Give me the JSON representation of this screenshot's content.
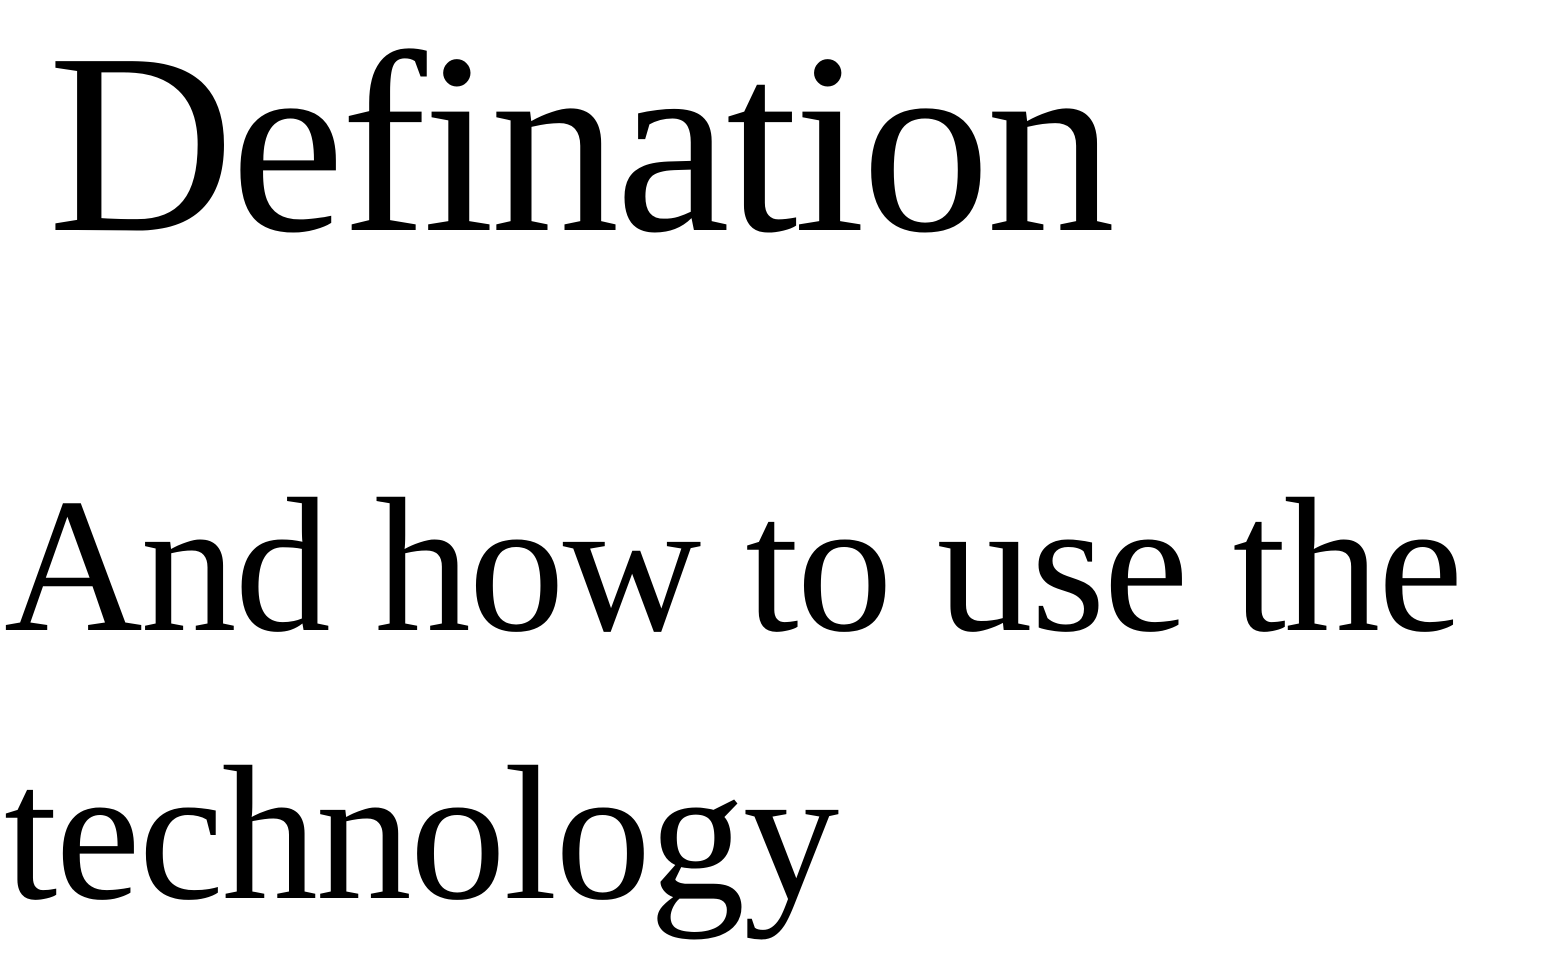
{
  "document": {
    "title": "Defination",
    "subtitle": "And how to use the technology"
  }
}
